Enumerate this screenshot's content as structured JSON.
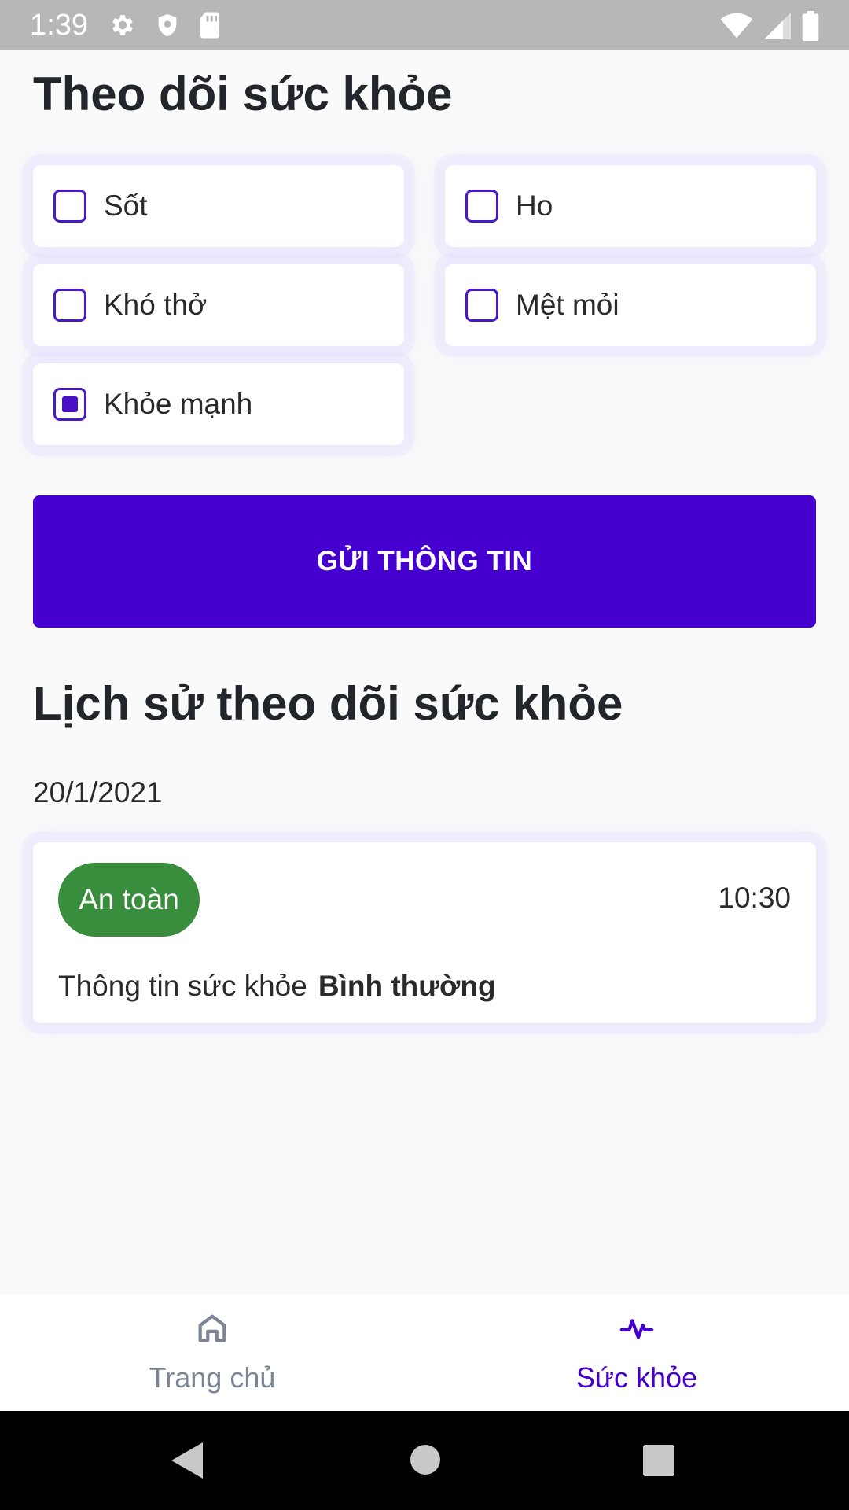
{
  "status_bar": {
    "time": "1:39"
  },
  "page": {
    "title": "Theo dõi sức khỏe",
    "symptoms": [
      {
        "label": "Sốt",
        "checked": false
      },
      {
        "label": "Ho",
        "checked": false
      },
      {
        "label": "Khó thở",
        "checked": false
      },
      {
        "label": "Mệt mỏi",
        "checked": false
      },
      {
        "label": "Khỏe mạnh",
        "checked": true
      }
    ],
    "submit_label": "GỬI THÔNG TIN",
    "history_title": "Lịch sử theo dõi sức khỏe",
    "history": [
      {
        "date": "20/1/2021",
        "status": "An toàn",
        "status_color": "#388e3c",
        "time": "10:30",
        "info_label": "Thông tin sức khỏe",
        "info_value": "Bình thường"
      }
    ]
  },
  "bottom_nav": {
    "items": [
      {
        "label": "Trang chủ",
        "icon": "home-icon",
        "active": false
      },
      {
        "label": "Sức khỏe",
        "icon": "pulse-icon",
        "active": true
      }
    ]
  },
  "colors": {
    "accent": "#4500cf",
    "safe": "#388e3c"
  }
}
